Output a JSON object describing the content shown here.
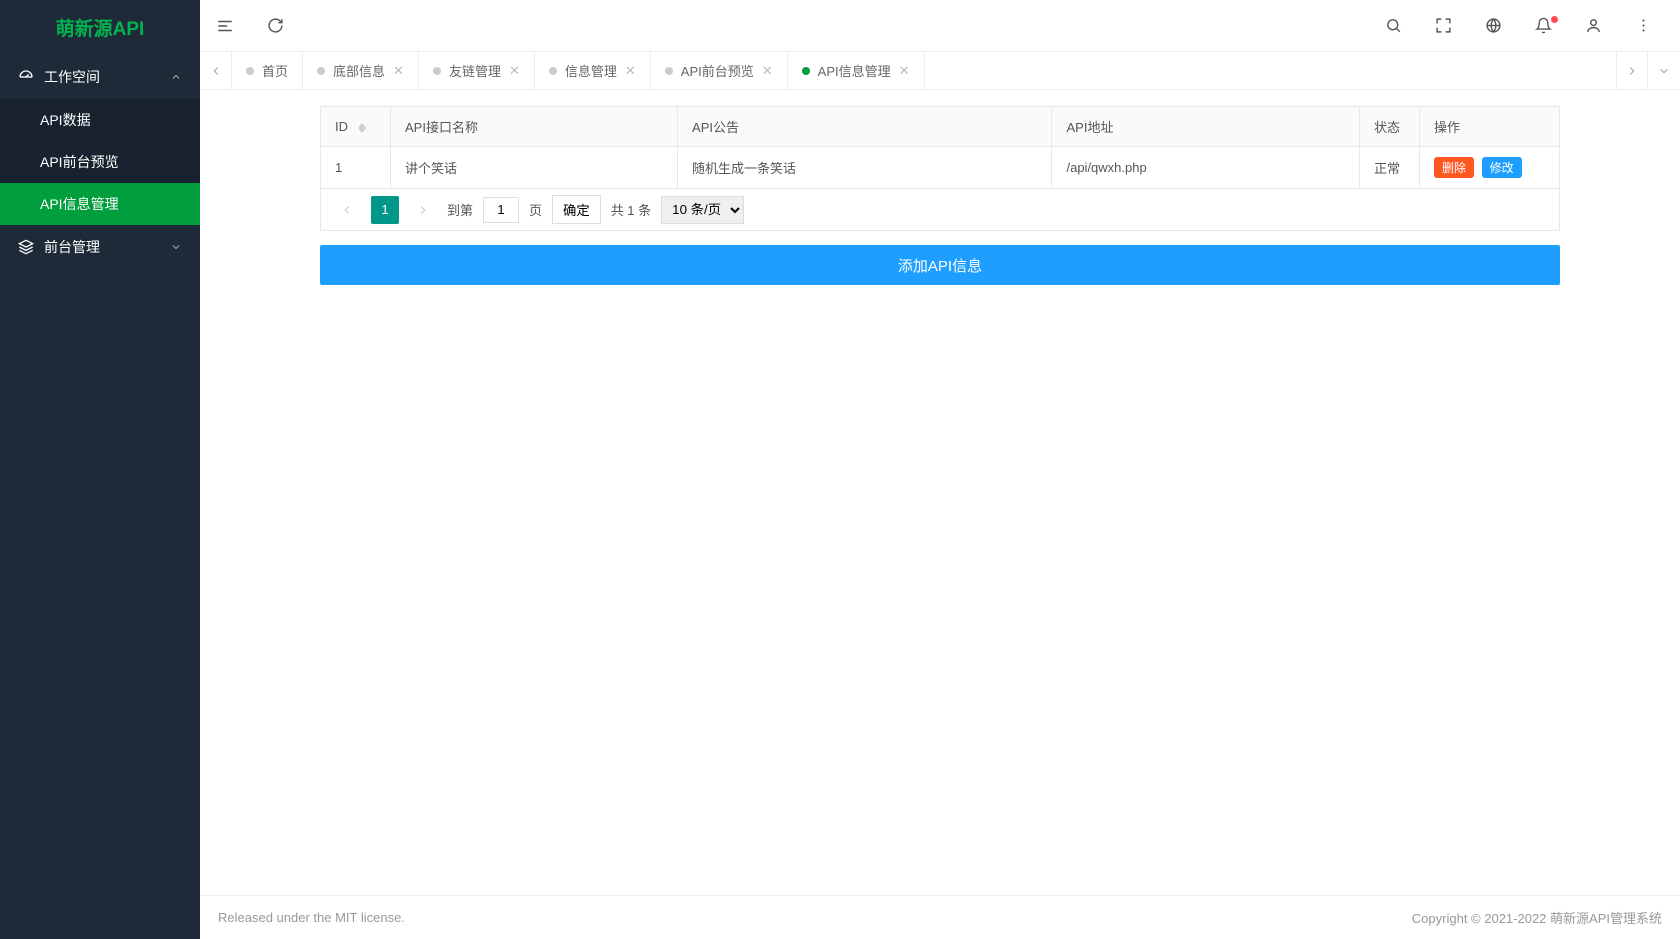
{
  "brand": "萌新源API",
  "sidebar": {
    "groups": [
      {
        "label": "工作空间",
        "expanded": true,
        "items": [
          {
            "label": "API数据"
          },
          {
            "label": "API前台预览"
          },
          {
            "label": "API信息管理",
            "active": true
          }
        ]
      },
      {
        "label": "前台管理",
        "expanded": false,
        "items": []
      }
    ]
  },
  "tabs": [
    {
      "label": "首页",
      "closable": false
    },
    {
      "label": "底部信息",
      "closable": true
    },
    {
      "label": "友链管理",
      "closable": true
    },
    {
      "label": "信息管理",
      "closable": true
    },
    {
      "label": "API前台预览",
      "closable": true
    },
    {
      "label": "API信息管理",
      "closable": true,
      "active": true
    }
  ],
  "table": {
    "headers": {
      "id": "ID",
      "name": "API接口名称",
      "notice": "API公告",
      "url": "API地址",
      "status": "状态",
      "action": "操作"
    },
    "rows": [
      {
        "id": "1",
        "name": "讲个笑话",
        "notice": "随机生成一条笑话",
        "url": "/api/qwxh.php",
        "status": "正常"
      }
    ],
    "actions": {
      "delete": "删除",
      "edit": "修改"
    }
  },
  "pager": {
    "current": "1",
    "go_prefix": "到第",
    "go_suffix": "页",
    "confirm": "确定",
    "total": "共 1 条",
    "page_size": "10 条/页"
  },
  "add_button": "添加API信息",
  "footer": {
    "left": "Released under the MIT license.",
    "right_prefix": "Copyright © 2021-2022 ",
    "right_suffix": "萌新源API管理系统"
  }
}
